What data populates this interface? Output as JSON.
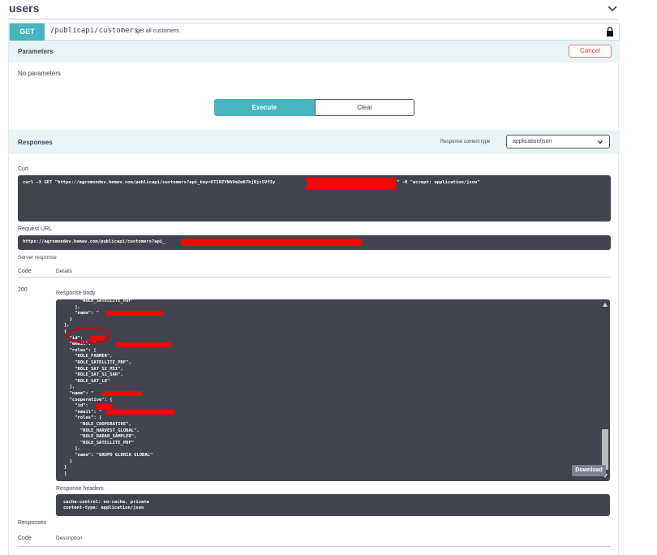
{
  "section": {
    "title": "users"
  },
  "operation": {
    "method": "GET",
    "path": "/publicapi/customers",
    "description": "get all customers"
  },
  "parameters": {
    "title": "Parameters",
    "cancel_label": "Cancel",
    "empty_text": "No parameters"
  },
  "actions": {
    "execute_label": "Execute",
    "clear_label": "Clear"
  },
  "responses_panel": {
    "title": "Responses",
    "content_type_label": "Response content type",
    "content_type_value": "application/json"
  },
  "curl": {
    "label": "Curl",
    "command_start": "curl -X GET \"https://agromondev.hemav.com/publicapi/customers?api_key=6TI0ZYNhVm2m07hjBjc5VfIy",
    "command_end": "\" -H \"accept: application/json\""
  },
  "request_url": {
    "label": "Request URL",
    "value": "https://agromondev.hemav.com/publicapi/customers?api_"
  },
  "server_response": {
    "label": "Server response",
    "code_header": "Code",
    "details_header": "Details",
    "code": "200",
    "body_label": "Response body",
    "body_lines": [
      "      \"ROLE_SATELLITE_PDF\"",
      "    ],",
      "    \"name\": \"",
      "  }",
      "},",
      "{",
      "  \"id\": ",
      "  \"email\": \"",
      "  \"roles\": [",
      "    \"ROLE_FARMER\",",
      "    \"ROLE_SATELLITE_PDF\",",
      "    \"ROLE_SAT_S2_MSI\",",
      "    \"ROLE_SAT_S1_SAR\",",
      "    \"ROLE_SAT_L8\"",
      "  ],",
      "  \"name\": \"",
      "  \"cooperative\": {",
      "    \"id\": ",
      "    \"email\": \"",
      "    \"roles\": [",
      "      \"ROLE_COOPERATIVE\",",
      "      \"ROLE_HARVEST_GLOBAL\",",
      "      \"ROLE_RADAR_SAMPLER\",",
      "      \"ROLE_SATELLITE_PDF\"",
      "    ],",
      "    \"name\": \"GRUPO GLORIA GLOBAL\"",
      "  }",
      "}",
      "]"
    ],
    "download_label": "Download",
    "headers_label": "Response headers",
    "headers_lines": [
      "cache-control: no-cache, private",
      "content-type: application/json"
    ]
  },
  "documented_responses": {
    "title": "Responses",
    "code_header": "Code",
    "description_header": "Description"
  },
  "icons": {
    "chevron": "chevron-down-icon",
    "lock": "lock-icon"
  },
  "colors": {
    "get_accent": "#47b5be",
    "panel_bg": "#e8f4f6",
    "code_bg": "#41444e",
    "cancel_red": "#e04040",
    "redaction": "#ff0000"
  }
}
